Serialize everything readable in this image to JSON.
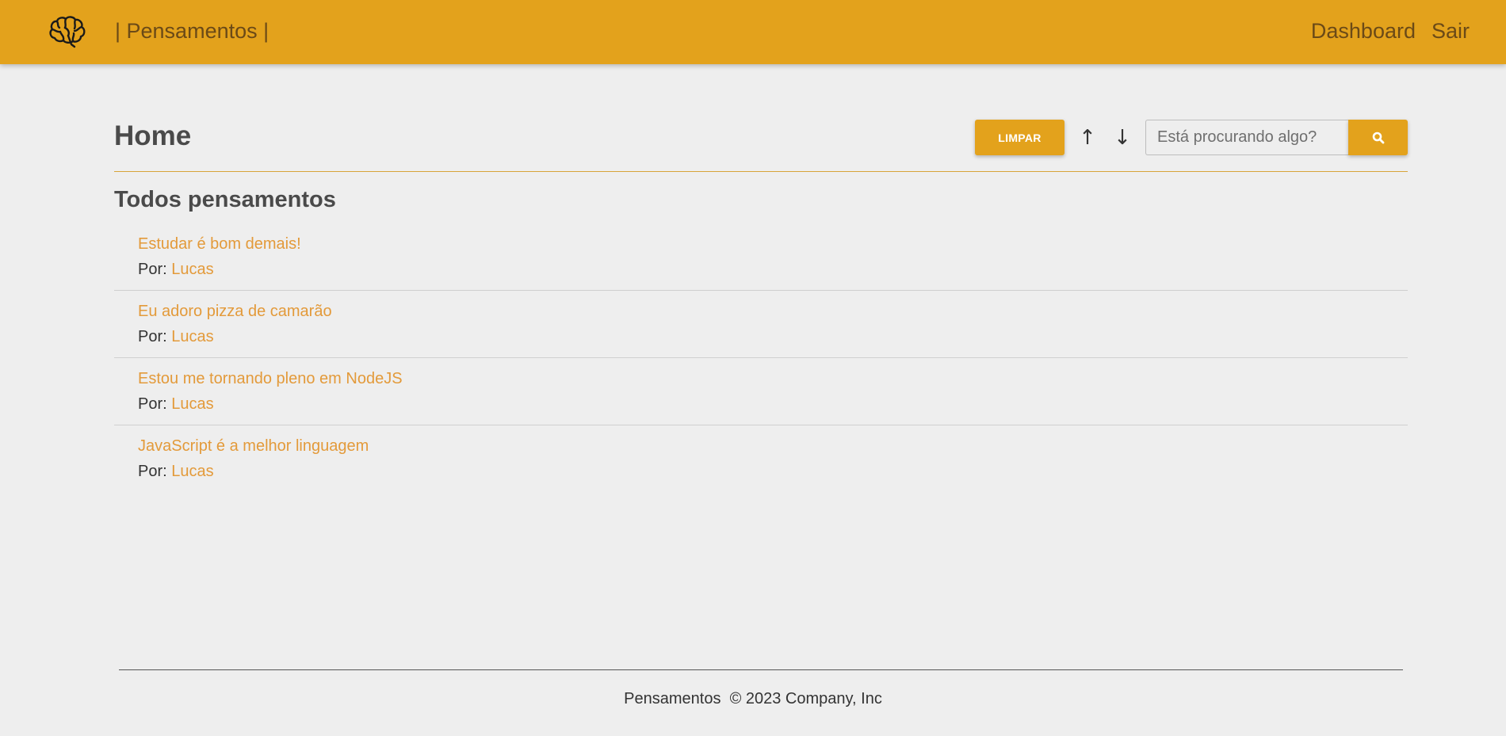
{
  "navbar": {
    "logo_icon": "brain-icon",
    "brand": "| Pensamentos |",
    "links": [
      {
        "label": "Dashboard"
      },
      {
        "label": "Sair"
      }
    ],
    "background_color": "#e3a21c"
  },
  "page": {
    "title": "Home"
  },
  "toolbar": {
    "clear_label": "LIMPAR",
    "sort_asc_icon": "arrow-up-icon",
    "sort_asc_glyph": "↑",
    "sort_desc_icon": "arrow-down-icon",
    "sort_desc_glyph": "↓",
    "search_placeholder": "Está procurando algo?",
    "search_icon": "search-icon"
  },
  "section": {
    "title": "Todos pensamentos"
  },
  "thoughts": [
    {
      "title": "Estudar é bom demais!",
      "by_label": "Por:",
      "author": "Lucas"
    },
    {
      "title": "Eu adoro pizza de camarão",
      "by_label": "Por:",
      "author": "Lucas"
    },
    {
      "title": "Estou me tornando pleno em NodeJS",
      "by_label": "Por:",
      "author": "Lucas"
    },
    {
      "title": "JavaScript é a melhor linguagem",
      "by_label": "Por:",
      "author": "Lucas"
    }
  ],
  "footer": {
    "text": "Pensamentos  © 2023 Company, Inc"
  },
  "colors": {
    "accent": "#e3a21c",
    "link": "#e39a3a",
    "background": "#eeeeee"
  }
}
